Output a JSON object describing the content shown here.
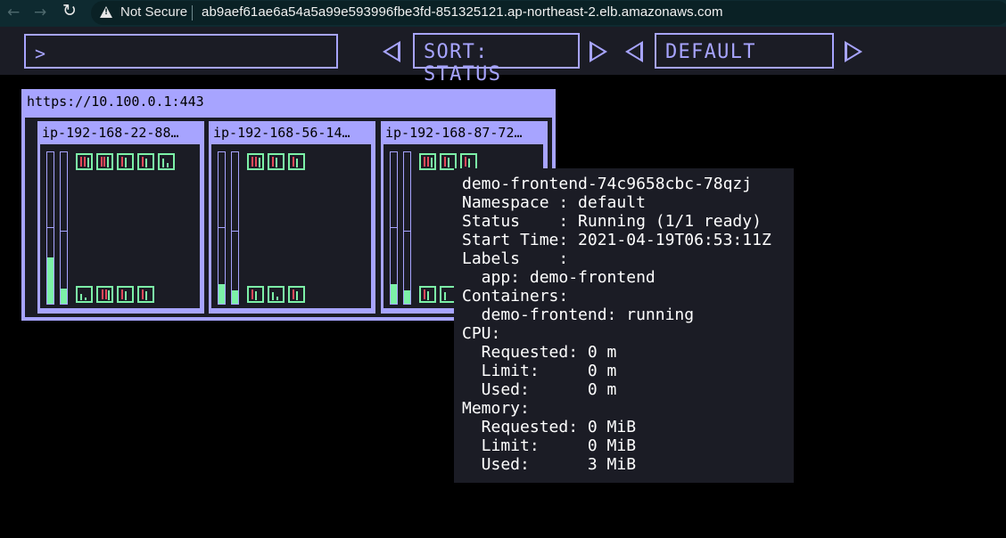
{
  "browser": {
    "back_icon": "arrow-left-icon",
    "forward_icon": "arrow-right-icon",
    "reload_icon": "reload-icon",
    "security_label": "Not Secure",
    "url": "ab9aef61ae6a54a5a99e593996fbe3fd-851325121.ap-northeast-2.elb.amazonaws.com"
  },
  "toolbar": {
    "filter_value": ">",
    "sort_label": "SORT: STATUS",
    "namespace_label": "DEFAULT"
  },
  "cluster": {
    "title": "https://10.100.0.1:443",
    "nodes": [
      {
        "name": "ip-192-168-22-88…"
      },
      {
        "name": "ip-192-168-56-14…"
      },
      {
        "name": "ip-192-168-87-72…"
      }
    ]
  },
  "tooltip": {
    "lines": [
      "demo-frontend-74c9658cbc-78qzj",
      "Namespace : default",
      "Status    : Running (1/1 ready)",
      "Start Time: 2021-04-19T06:53:11Z",
      "Labels    :",
      "  app: demo-frontend",
      "Containers:",
      "  demo-frontend: running",
      "CPU:",
      "  Requested: 0 m",
      "  Limit:     0 m",
      "  Used:      0 m",
      "Memory:",
      "  Requested: 0 MiB",
      "  Limit:     0 MiB",
      "  Used:      3 MiB"
    ]
  },
  "colors": {
    "accent": "#a7a4ff",
    "panel": "#1b1c25",
    "pod_ok": "#7cf1a7",
    "cpu": "#e5485a"
  }
}
